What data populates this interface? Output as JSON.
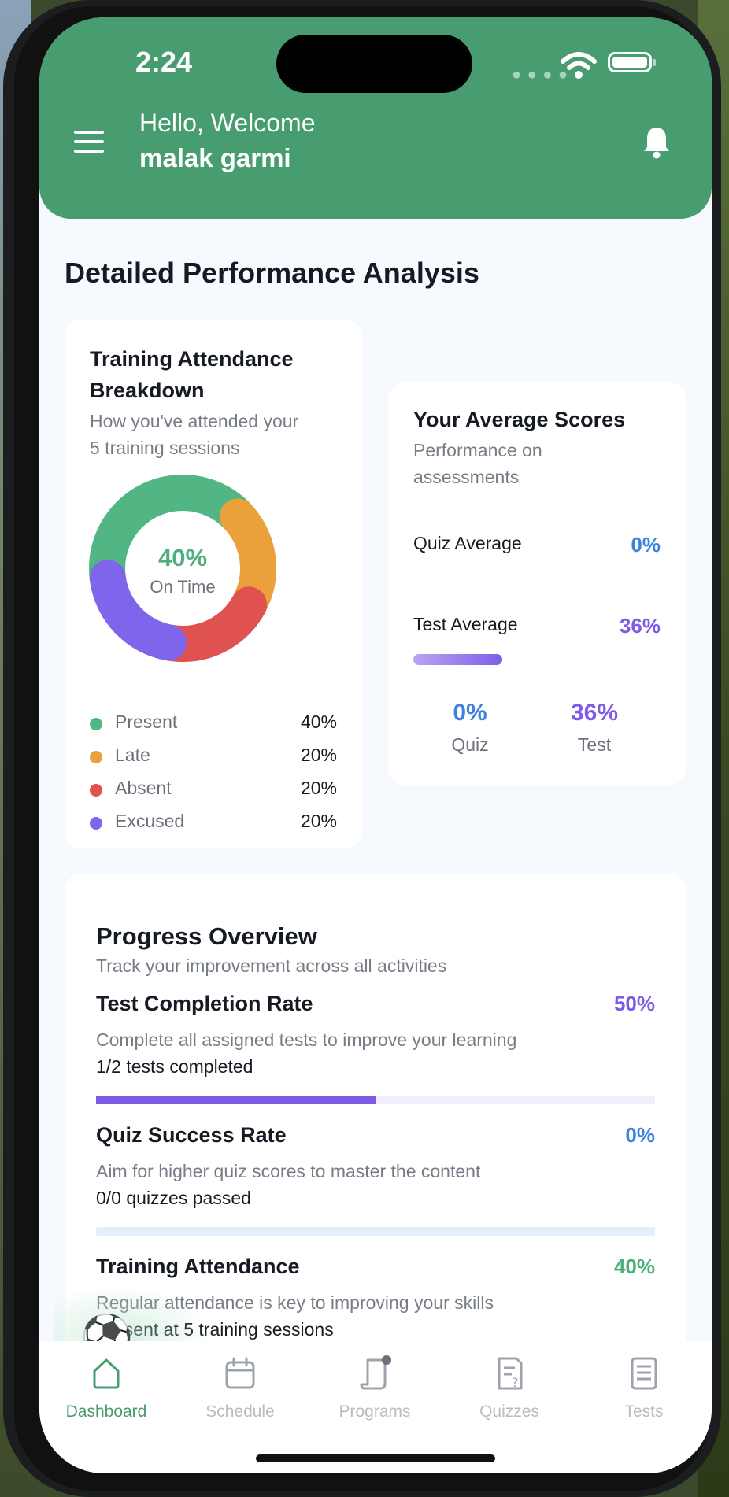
{
  "status": {
    "time": "2:24"
  },
  "header": {
    "greeting": "Hello, Welcome",
    "username": "malak garmi"
  },
  "page": {
    "title": "Detailed Performance Analysis"
  },
  "attendance": {
    "title_line1": "Training Attendance",
    "title_line2": "Breakdown",
    "subtitle_line1": "How you've attended your",
    "subtitle_line2": "5 training sessions",
    "center_percent": "40%",
    "center_label": "On Time",
    "legend": [
      {
        "name": "Present",
        "value": "40%",
        "color": "#52b584",
        "fraction": 0.4
      },
      {
        "name": "Late",
        "value": "20%",
        "color": "#eaa03b",
        "fraction": 0.2
      },
      {
        "name": "Absent",
        "value": "20%",
        "color": "#e05252",
        "fraction": 0.2
      },
      {
        "name": "Excused",
        "value": "20%",
        "color": "#7f65ec",
        "fraction": 0.2
      }
    ]
  },
  "scores": {
    "title": "Your Average Scores",
    "subtitle_line1": "Performance on",
    "subtitle_line2": "assessments",
    "quiz_label": "Quiz Average",
    "quiz_value": "0%",
    "test_label": "Test Average",
    "test_value": "36%",
    "test_fraction": 0.36,
    "summary_quiz_value": "0%",
    "summary_quiz_label": "Quiz",
    "summary_test_value": "36%",
    "summary_test_label": "Test",
    "quiz_color": "#3d82e0",
    "test_color": "#7f5ce6"
  },
  "progress": {
    "title": "Progress Overview",
    "subtitle": "Track your improvement across all activities",
    "items": [
      {
        "title": "Test Completion Rate",
        "percent": "50%",
        "fraction": 0.5,
        "description": "Complete all assigned tests to improve your learning",
        "count": "1/2 tests completed",
        "color": "#7f5ce6",
        "track": "#f0edfd"
      },
      {
        "title": "Quiz Success Rate",
        "percent": "0%",
        "fraction": 0,
        "description": "Aim for higher quiz scores to master the content",
        "count": "0/0 quizzes passed",
        "color": "#3d82e0",
        "track": "#e6eefb"
      },
      {
        "title": "Training Attendance",
        "percent": "40%",
        "fraction": 0.4,
        "description": "Regular attendance is key to improving your skills",
        "count": "Present at 5 training sessions",
        "color": "#4caf7d",
        "track": "#e6f5ec"
      }
    ]
  },
  "tabs": [
    {
      "label": "Dashboard",
      "icon": "home-icon",
      "active": true
    },
    {
      "label": "Schedule",
      "icon": "calendar-icon",
      "active": false
    },
    {
      "label": "Programs",
      "icon": "scroll-icon",
      "active": false
    },
    {
      "label": "Quizzes",
      "icon": "quiz-icon",
      "active": false
    },
    {
      "label": "Tests",
      "icon": "document-icon",
      "active": false
    }
  ],
  "colors": {
    "brand": "#479c70",
    "background": "#f6f9fd"
  },
  "floating": {
    "icon": "soccer-ball-icon"
  }
}
